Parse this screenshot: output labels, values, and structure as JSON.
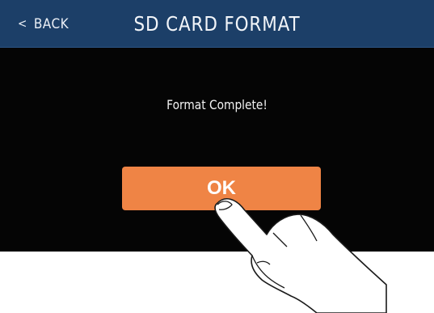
{
  "header": {
    "back_chevron": "<",
    "back_label": "BACK",
    "title": "SD CARD FORMAT"
  },
  "dialog": {
    "message": "Format Complete!",
    "ok_label": "OK"
  },
  "colors": {
    "header_bg": "#1c3f68",
    "screen_bg": "#050505",
    "ok_button": "#ef8445"
  },
  "icons": {
    "pointer": "tapping-hand-icon"
  }
}
